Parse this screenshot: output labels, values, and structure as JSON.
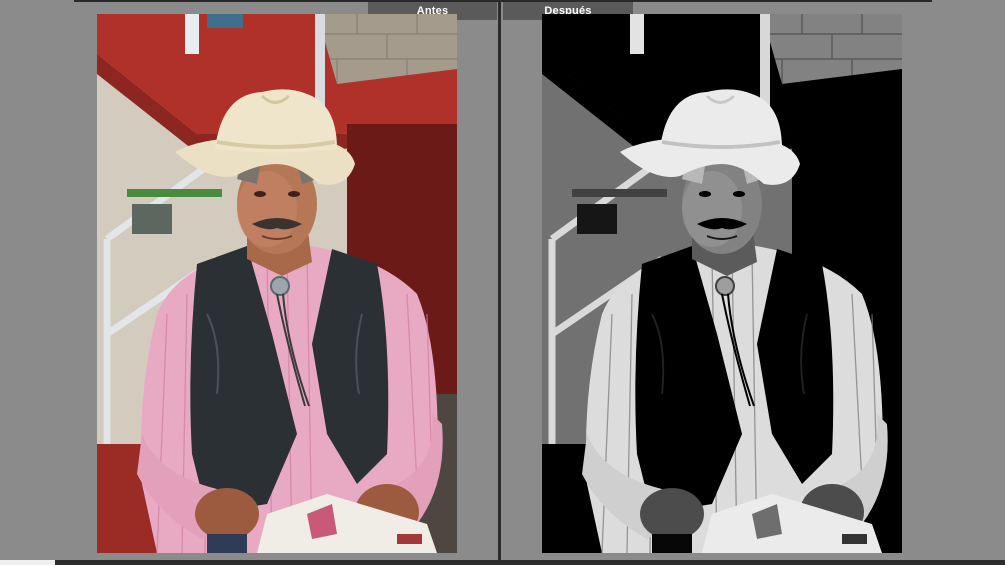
{
  "labels": {
    "before": "Antes",
    "after": "Después"
  },
  "colors": {
    "background": "#8b8b8b",
    "label_bg": "#5a5a5a",
    "label_text": "#ffffff",
    "divider": "#2c2c2c"
  },
  "photos": {
    "before": {
      "mode": "color"
    },
    "after": {
      "mode": "black-and-white"
    }
  }
}
